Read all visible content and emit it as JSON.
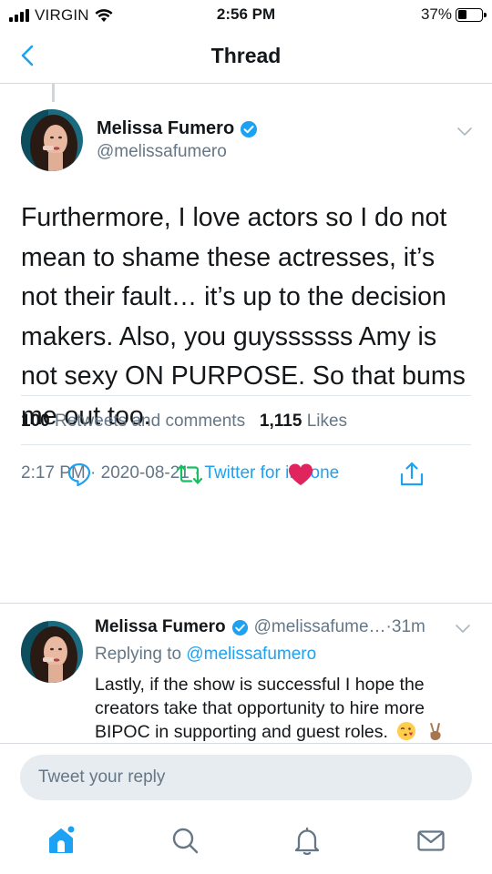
{
  "status_bar": {
    "carrier": "VIRGIN",
    "time": "2:56 PM",
    "battery": "37%",
    "battery_level": 0.37
  },
  "nav": {
    "title": "Thread",
    "back_icon": "chevron-left-icon"
  },
  "main_tweet": {
    "author": {
      "name": "Melissa Fumero",
      "handle": "@melissafumero",
      "verified": true
    },
    "text": "Furthermore, I love actors so I do not mean to shame these actresses, it’s not their fault… it’s up to the decision makers. Also, you guyssssss Amy is not sexy ON PURPOSE. So that bums me out too.",
    "time": "2:17 PM",
    "date": "2020-08-21",
    "meta_sep": " · ",
    "source": "Twitter for iPhone",
    "retweets_count": "100",
    "retweets_label": "Retweets and comments",
    "likes_count": "1,115",
    "likes_label": "Likes"
  },
  "actions": [
    {
      "name": "reply",
      "icon": "reply-icon"
    },
    {
      "name": "retweet",
      "icon": "retweet-icon"
    },
    {
      "name": "like",
      "icon": "heart-icon",
      "active": true
    },
    {
      "name": "share",
      "icon": "share-icon"
    }
  ],
  "reply_tweet": {
    "author": {
      "name": "Melissa Fumero",
      "handle": "@melissafume…",
      "verified": true
    },
    "time_ago": "31m",
    "header_sep": " · ",
    "replying_prefix": "Replying to",
    "replying_to": "@melissafumero",
    "text": "Lastly, if the show is successful I hope the creators take that opportunity to hire more BIPOC in supporting and guest roles.",
    "emojis": [
      "face-blowing-kiss-emoji",
      "victory-hand-emoji"
    ]
  },
  "reply_box": {
    "placeholder": "Tweet your reply"
  },
  "tab_bar": [
    {
      "name": "home",
      "icon": "home-icon",
      "active": true
    },
    {
      "name": "search",
      "icon": "search-icon"
    },
    {
      "name": "notifications",
      "icon": "bell-icon"
    },
    {
      "name": "messages",
      "icon": "mail-icon"
    }
  ],
  "colors": {
    "accent": "#1da1f2",
    "like": "#e0245e",
    "retweet": "#17bf63",
    "secondary_text": "#657786"
  }
}
